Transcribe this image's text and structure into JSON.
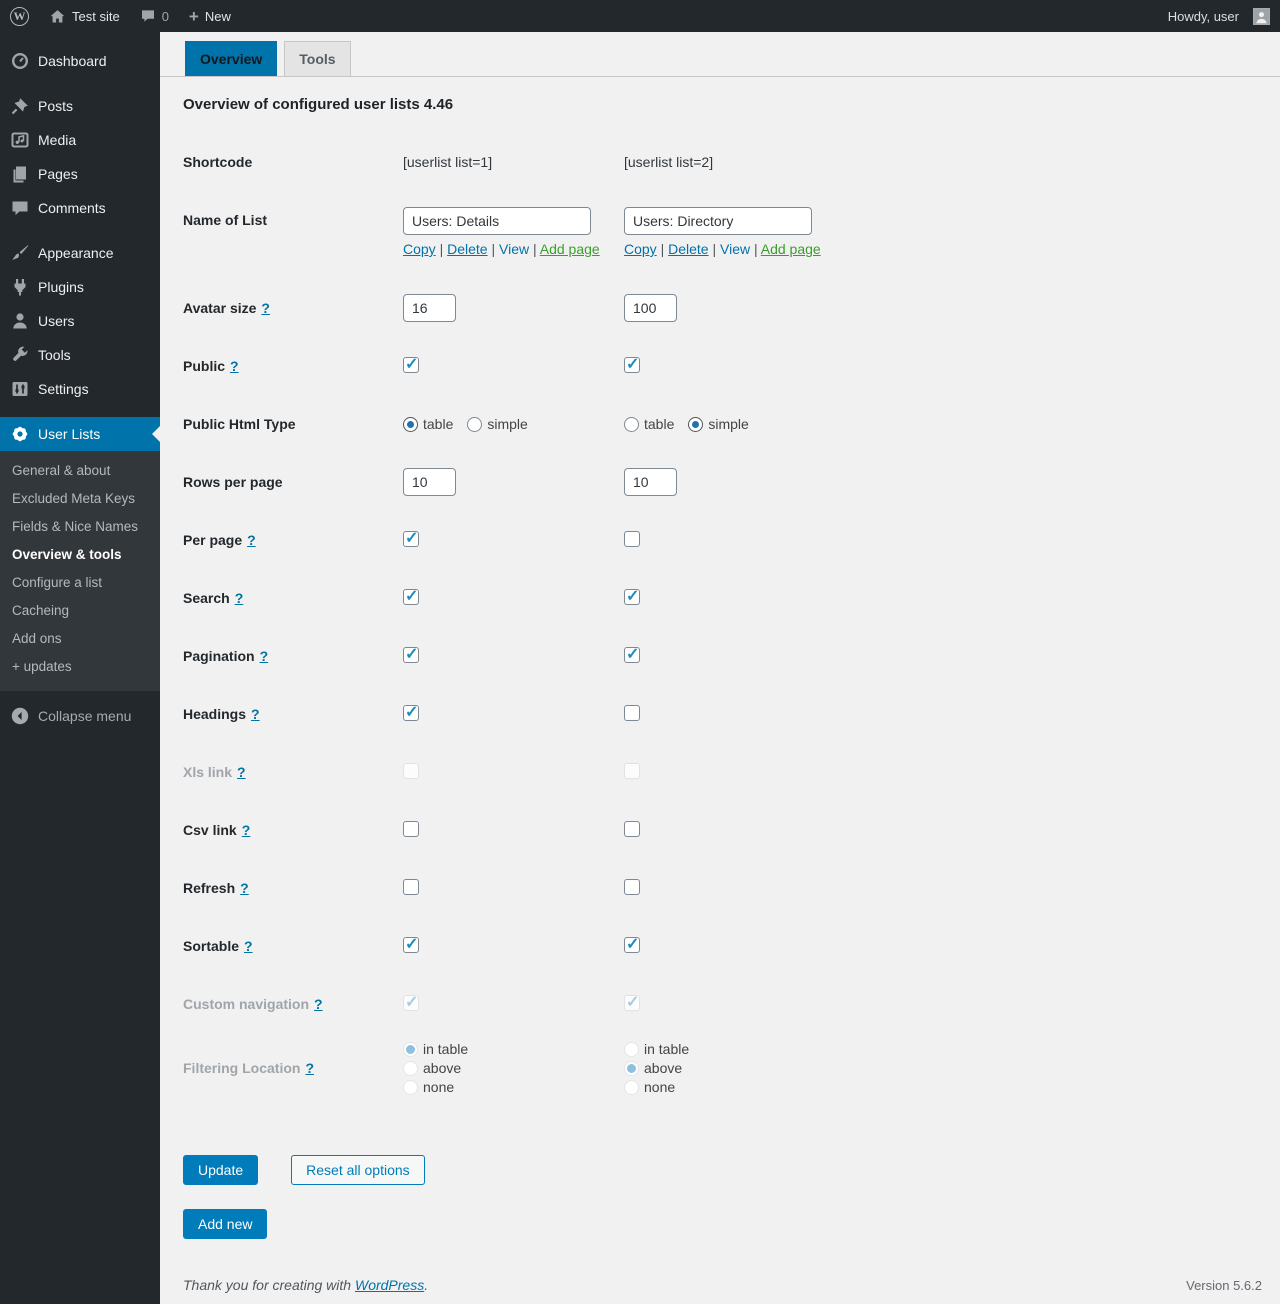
{
  "admin_bar": {
    "site_name": "Test site",
    "comment_count": "0",
    "new_label": "New",
    "howdy_text": "Howdy, user"
  },
  "sidebar": {
    "items": [
      {
        "label": "Dashboard",
        "icon": "dashboard-icon"
      },
      {
        "separator": true
      },
      {
        "label": "Posts",
        "icon": "pushpin-icon"
      },
      {
        "label": "Media",
        "icon": "media-icon"
      },
      {
        "label": "Pages",
        "icon": "pages-icon"
      },
      {
        "label": "Comments",
        "icon": "comments-icon"
      },
      {
        "separator": true
      },
      {
        "label": "Appearance",
        "icon": "brush-icon"
      },
      {
        "label": "Plugins",
        "icon": "plugin-icon"
      },
      {
        "label": "Users",
        "icon": "users-icon"
      },
      {
        "label": "Tools",
        "icon": "wrench-icon"
      },
      {
        "label": "Settings",
        "icon": "settings-icon"
      },
      {
        "separator": true
      },
      {
        "label": "User Lists",
        "icon": "gear-icon",
        "active": true
      }
    ],
    "submenu": [
      {
        "label": "General & about"
      },
      {
        "label": "Excluded Meta Keys"
      },
      {
        "label": "Fields & Nice Names"
      },
      {
        "label": "Overview & tools",
        "current": true
      },
      {
        "label": "Configure a list"
      },
      {
        "label": "Cacheing"
      },
      {
        "label": "Add ons"
      },
      {
        "label": "+ updates"
      }
    ],
    "collapse_label": "Collapse menu"
  },
  "tabs": [
    {
      "label": "Overview",
      "active": true
    },
    {
      "label": "Tools",
      "active": false
    }
  ],
  "page_title": "Overview of configured user lists 4.46",
  "form": {
    "help_symbol": "?",
    "action_links": [
      "Copy",
      "Delete",
      "View",
      "Add page"
    ],
    "rows": [
      {
        "id": "shortcode",
        "label": "Shortcode",
        "help": false,
        "type": "text",
        "cols": [
          "[userlist list=1]",
          "[userlist list=2]"
        ]
      },
      {
        "id": "name-of-list",
        "label": "Name of List",
        "help": false,
        "type": "input-with-links",
        "cols": [
          "Users: Details",
          "Users: Directory"
        ]
      },
      {
        "id": "avatar-size",
        "label": "Avatar size",
        "help": true,
        "type": "input-small",
        "cols": [
          "16",
          "100"
        ]
      },
      {
        "id": "public",
        "label": "Public",
        "help": true,
        "type": "checkbox",
        "cols": [
          true,
          true
        ]
      },
      {
        "id": "public-html-type",
        "label": "Public Html Type",
        "help": false,
        "type": "radio-inline",
        "options": [
          "table",
          "simple"
        ],
        "cols": [
          "table",
          "simple"
        ]
      },
      {
        "id": "rows-per-page",
        "label": "Rows per page",
        "help": false,
        "type": "input-small",
        "cols": [
          "10",
          "10"
        ]
      },
      {
        "id": "per-page",
        "label": "Per page",
        "help": true,
        "type": "checkbox",
        "cols": [
          true,
          false
        ]
      },
      {
        "id": "search",
        "label": "Search",
        "help": true,
        "type": "checkbox",
        "cols": [
          true,
          true
        ]
      },
      {
        "id": "pagination",
        "label": "Pagination",
        "help": true,
        "type": "checkbox",
        "cols": [
          true,
          true
        ]
      },
      {
        "id": "headings",
        "label": "Headings",
        "help": true,
        "type": "checkbox",
        "cols": [
          true,
          false
        ]
      },
      {
        "id": "xls-link",
        "label": "Xls link",
        "help": true,
        "type": "checkbox",
        "disabled": true,
        "cols": [
          false,
          false
        ]
      },
      {
        "id": "csv-link",
        "label": "Csv link",
        "help": true,
        "type": "checkbox",
        "cols": [
          false,
          false
        ]
      },
      {
        "id": "refresh",
        "label": "Refresh",
        "help": true,
        "type": "checkbox",
        "cols": [
          false,
          false
        ]
      },
      {
        "id": "sortable",
        "label": "Sortable",
        "help": true,
        "type": "checkbox",
        "cols": [
          true,
          true
        ]
      },
      {
        "id": "custom-navigation",
        "label": "Custom navigation",
        "help": true,
        "type": "checkbox",
        "disabled": true,
        "cols": [
          true,
          true
        ]
      },
      {
        "id": "filtering-location",
        "label": "Filtering Location",
        "help": true,
        "type": "radio-stack",
        "disabled": true,
        "options": [
          "in table",
          "above",
          "none"
        ],
        "cols": [
          "in table",
          "above"
        ]
      }
    ],
    "buttons": {
      "update": "Update",
      "reset": "Reset all options",
      "add_new": "Add new"
    }
  },
  "footer": {
    "thanks_prefix": "Thank you for creating with ",
    "wordpress_link": "WordPress",
    "thanks_suffix": ".",
    "version": "Version 5.6.2"
  },
  "colors": {
    "accent": "#0073aa",
    "primary_button": "#007cba",
    "content_bg": "#f1f1f1",
    "menu_bg": "#23282d",
    "submenu_bg": "#32373c",
    "link_blue": "#0073aa",
    "link_green": "#3a9e2d",
    "check_blue": "#1e8cbe",
    "disabled_text": "#a0a5aa"
  }
}
